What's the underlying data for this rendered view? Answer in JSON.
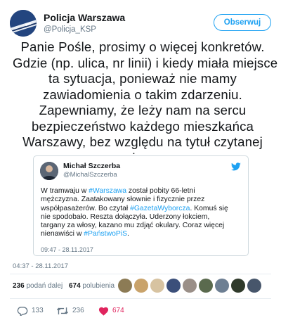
{
  "author": {
    "name": "Policja Warszawa",
    "handle": "@Policja_KSP",
    "avatar_icon": "police-car-avatar"
  },
  "follow_label": "Obserwuj",
  "tweet_lines": [
    "Panie Pośle, prosimy o więcej konkretów.",
    "Gdzie (np. ulica, nr linii) i kiedy miała miejsce",
    "ta sytuacja, ponieważ nie mamy",
    "zawiadomienia o takim zdarzeniu.",
    "Zapewniamy, że leży nam na sercu",
    "bezpieczeństwo każdego mieszkańca",
    "Warszawy, bez względu na tytuł czytanej",
    "przez niego prasy."
  ],
  "quote": {
    "name": "Michał Szczerba",
    "handle": "@MichalSzczerba",
    "lines": [
      [
        {
          "t": "W tramwaju w "
        },
        {
          "t": "#Warszawa",
          "tag": true
        },
        {
          "t": " został pobity 66-letni"
        }
      ],
      [
        {
          "t": "mężczyzna. Zaatakowany słownie i fizycznie przez"
        }
      ],
      [
        {
          "t": "współpasażerów. Bo czytał "
        },
        {
          "t": "#GazetaWyborcza",
          "tag": true
        },
        {
          "t": ". Komuś się"
        }
      ],
      [
        {
          "t": "nie spodobało. Reszta dołączyła. Uderzony łokciem,"
        }
      ],
      [
        {
          "t": "targany za włosy, kazano mu zdjąć okulary. Coraz więcej"
        }
      ],
      [
        {
          "t": "nienawiści w "
        },
        {
          "t": "#PaństwoPiS",
          "tag": true
        },
        {
          "t": "."
        }
      ]
    ],
    "time": "09:47 - 28.11.2017"
  },
  "timestamp": "04:37 - 28.11.2017",
  "stats": {
    "retweets_count": "236",
    "retweets_label": "podań dalej",
    "likes_count": "674",
    "likes_label": "polubienia"
  },
  "likers": [
    "#8c7b55",
    "#c9a36b",
    "#d7c3a1",
    "#3b4f7a",
    "#9a8f88",
    "#5a6a4e",
    "#6d7f93",
    "#2f3a2b",
    "#47566b"
  ],
  "actions": {
    "reply_count": "133",
    "retweet_count": "236",
    "like_count": "674"
  },
  "colors": {
    "accent": "#1da1f2",
    "like": "#e0245e",
    "muted": "#657786"
  }
}
